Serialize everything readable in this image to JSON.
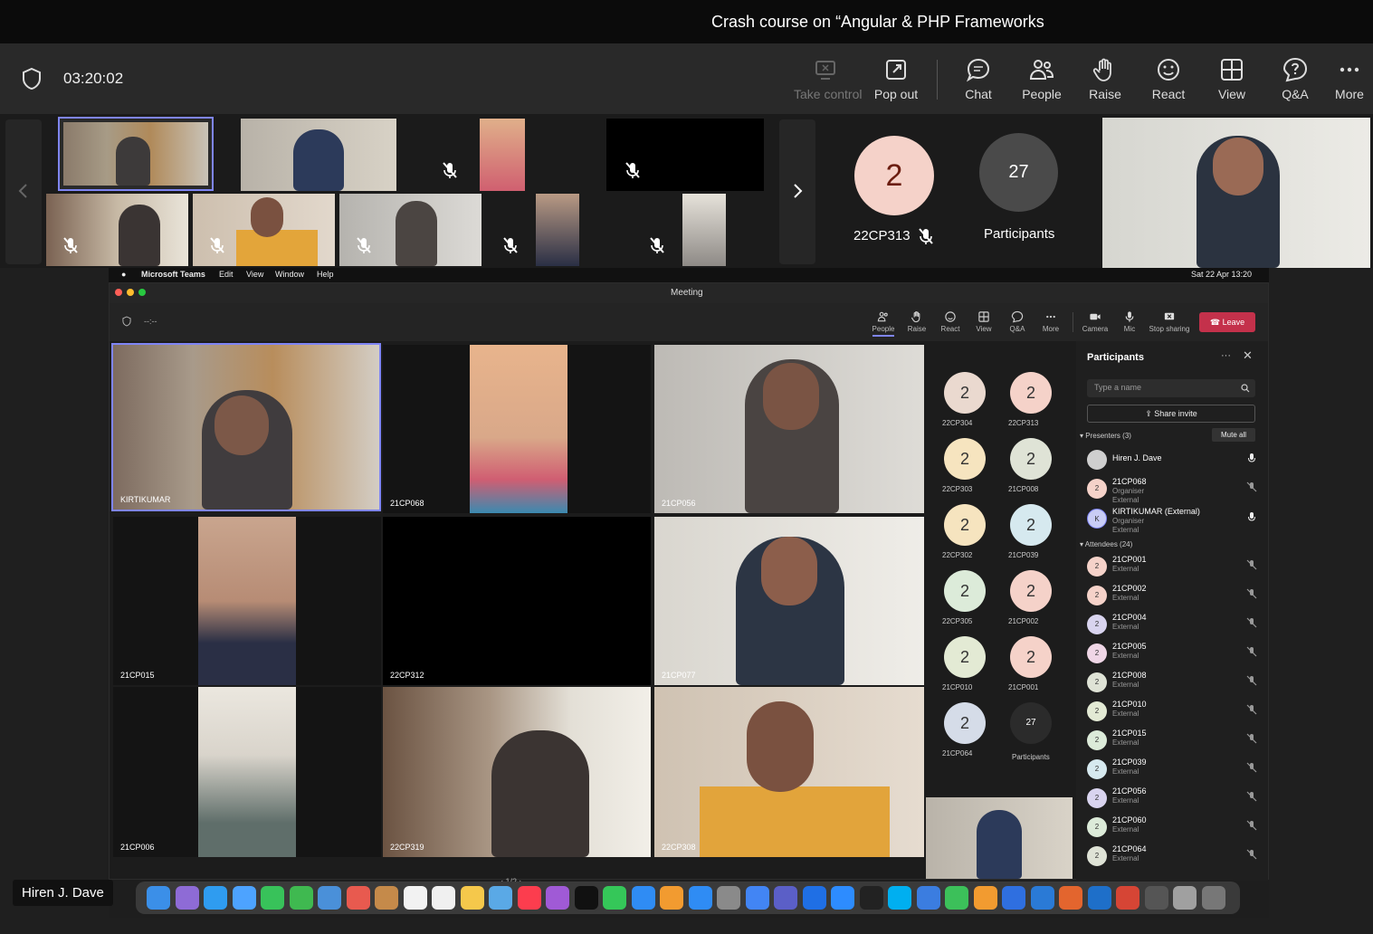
{
  "window": {
    "title": "Crash course on “Angular & PHP Frameworks"
  },
  "toolbar": {
    "timer": "03:20:02",
    "take_control": "Take control",
    "pop_out": "Pop out",
    "chat": "Chat",
    "people": "People",
    "raise": "Raise",
    "react": "React",
    "view": "View",
    "qa": "Q&A",
    "more": "More"
  },
  "strip": {
    "overflow_count": "2",
    "overflow_name": "22CP313",
    "participants_count": "27",
    "participants_label": "Participants"
  },
  "shared_screen": {
    "menubar": {
      "app": "Microsoft Teams",
      "edit": "Edit",
      "view": "View",
      "window": "Window",
      "help": "Help",
      "clock": "Sat 22 Apr  13:20"
    },
    "window_title": "Meeting",
    "timer": "--:--",
    "toolbar": {
      "people": "People",
      "raise": "Raise",
      "react": "React",
      "view": "View",
      "qa": "Q&A",
      "more": "More",
      "camera": "Camera",
      "mic": "Mic",
      "stop_sharing": "Stop sharing",
      "leave": "Leave"
    },
    "tiles": [
      {
        "name": "KIRTIKUMAR"
      },
      {
        "name": "21CP068"
      },
      {
        "name": "21CP056"
      },
      {
        "name": "21CP015"
      },
      {
        "name": "22CP312"
      },
      {
        "name": "21CP077"
      },
      {
        "name": "21CP006"
      },
      {
        "name": "22CP319"
      },
      {
        "name": "22CP308"
      }
    ],
    "overflow": [
      {
        "name": "22CP304",
        "count": "2",
        "color": "#ead9cf"
      },
      {
        "name": "22CP313",
        "count": "2",
        "color": "#f5d2c9"
      },
      {
        "name": "22CP303",
        "count": "2",
        "color": "#f6e4bf"
      },
      {
        "name": "21CP008",
        "count": "2",
        "color": "#dfe3d6"
      },
      {
        "name": "22CP302",
        "count": "2",
        "color": "#f6e4bf"
      },
      {
        "name": "21CP039",
        "count": "2",
        "color": "#d6e9ef"
      },
      {
        "name": "22CP305",
        "count": "2",
        "color": "#dcebd9"
      },
      {
        "name": "21CP002",
        "count": "2",
        "color": "#f5d2c9"
      },
      {
        "name": "21CP010",
        "count": "2",
        "color": "#e3ead4"
      },
      {
        "name": "21CP001",
        "count": "2",
        "color": "#f5d2c9"
      },
      {
        "name": "21CP064",
        "count": "2",
        "color": "#d5dce8"
      },
      {
        "name": "Participants",
        "count": "27",
        "color": "#2b2b2b"
      }
    ],
    "pager": "1/2",
    "panel": {
      "title": "Participants",
      "search_placeholder": "Type a name",
      "share_invite": "Share invite",
      "presenters_label": "Presenters (3)",
      "mute_all": "Mute all",
      "attendees_label": "Attendees (24)",
      "presenters": [
        {
          "name": "Hiren J. Dave",
          "role": "",
          "role2": "",
          "initial": "",
          "color": "#cfcfcf"
        },
        {
          "name": "21CP068",
          "role": "Organiser",
          "role2": "External",
          "initial": "2",
          "color": "#f5d2c9"
        },
        {
          "name": "KIRTIKUMAR (External)",
          "role": "Organiser",
          "role2": "External",
          "initial": "K",
          "color": "#c9cdf5"
        }
      ],
      "attendees": [
        {
          "name": "21CP001",
          "role": "External",
          "initial": "2",
          "color": "#f5d2c9"
        },
        {
          "name": "21CP002",
          "role": "External",
          "initial": "2",
          "color": "#f5d2c9"
        },
        {
          "name": "21CP004",
          "role": "External",
          "initial": "2",
          "color": "#d9d4ef"
        },
        {
          "name": "21CP005",
          "role": "External",
          "initial": "2",
          "color": "#efd6e6"
        },
        {
          "name": "21CP008",
          "role": "External",
          "initial": "2",
          "color": "#dfe3d6"
        },
        {
          "name": "21CP010",
          "role": "External",
          "initial": "2",
          "color": "#e3ead4"
        },
        {
          "name": "21CP015",
          "role": "External",
          "initial": "2",
          "color": "#dcebd9"
        },
        {
          "name": "21CP039",
          "role": "External",
          "initial": "2",
          "color": "#d6e9ef"
        },
        {
          "name": "21CP056",
          "role": "External",
          "initial": "2",
          "color": "#d9d4ef"
        },
        {
          "name": "21CP060",
          "role": "External",
          "initial": "2",
          "color": "#dcebd9"
        },
        {
          "name": "21CP064",
          "role": "External",
          "initial": "2",
          "color": "#dfe3d6"
        }
      ]
    }
  },
  "presenter_label": "Hiren J. Dave",
  "colors": {
    "accent": "#7f85f5",
    "leave": "#c4314b",
    "avatar_peach": "#f5d2c9"
  }
}
